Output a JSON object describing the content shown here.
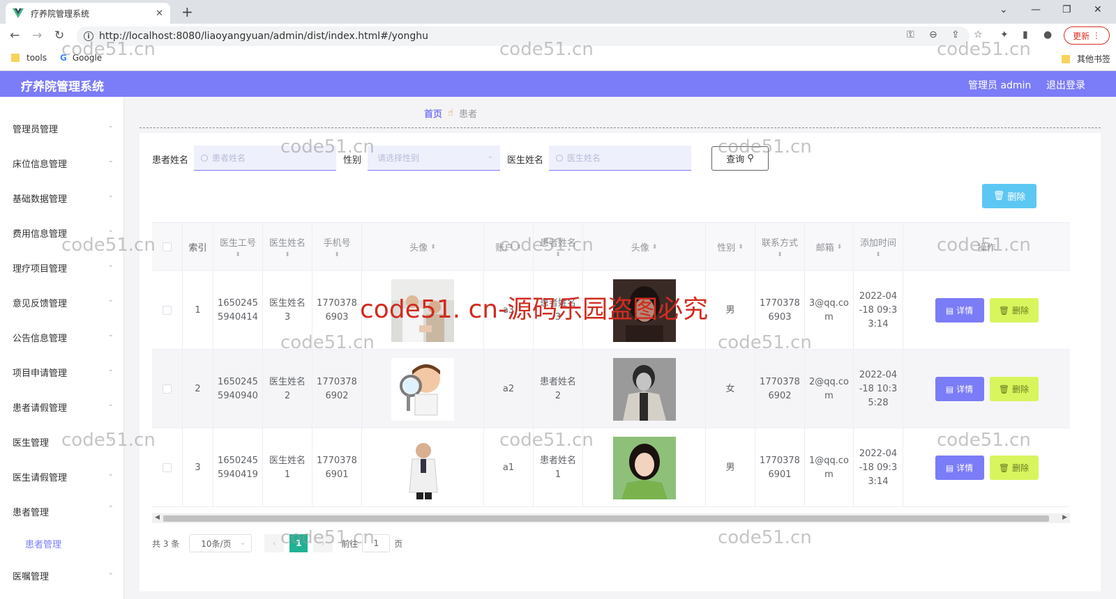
{
  "browser": {
    "tab_title": "疗养院管理系统",
    "url": "http://localhost:8080/liaoyangyuan/admin/dist/index.html#/yonghu",
    "update_label": "更新",
    "bookmarks": [
      "tools",
      "Google"
    ],
    "other_bookmarks": "其他书签"
  },
  "header": {
    "title": "疗养院管理系统",
    "admin": "管理员 admin",
    "logout": "退出登录"
  },
  "sidebar": {
    "items": [
      {
        "label": "管理员管理"
      },
      {
        "label": "床位信息管理"
      },
      {
        "label": "基础数据管理"
      },
      {
        "label": "费用信息管理"
      },
      {
        "label": "理疗项目管理"
      },
      {
        "label": "意见反馈管理"
      },
      {
        "label": "公告信息管理"
      },
      {
        "label": "项目申请管理"
      },
      {
        "label": "患者请假管理"
      },
      {
        "label": "医生管理"
      },
      {
        "label": "医生请假管理"
      },
      {
        "label": "患者管理"
      },
      {
        "label": "医嘱管理"
      }
    ],
    "sub_active": "患者管理"
  },
  "breadcrumb": {
    "home": "首页",
    "current": "患者"
  },
  "filters": {
    "patient_name_label": "患者姓名",
    "patient_name_placeholder": "患者姓名",
    "gender_label": "性别",
    "gender_placeholder": "请选择性别",
    "doctor_name_label": "医生姓名",
    "doctor_name_placeholder": "医生姓名",
    "query_label": "查询"
  },
  "actions": {
    "bulk_delete": "删除",
    "detail": "详情",
    "delete": "删除"
  },
  "table": {
    "columns": [
      "索引",
      "医生工号",
      "医生姓名",
      "手机号",
      "头像",
      "账户",
      "患者姓名",
      "头像",
      "性别",
      "联系方式",
      "邮箱",
      "添加时间",
      "操作"
    ],
    "rows": [
      {
        "index": "1",
        "doctor_no": "16502455940414",
        "doctor_name": "医生姓名3",
        "phone": "17703786903",
        "account": "a3",
        "patient_name": "患者姓名3",
        "gender": "男",
        "contact": "17703786903",
        "email": "3@qq.com",
        "added": "2022-04-18 09:33:14"
      },
      {
        "index": "2",
        "doctor_no": "16502455940940",
        "doctor_name": "医生姓名2",
        "phone": "17703786902",
        "account": "a2",
        "patient_name": "患者姓名2",
        "gender": "女",
        "contact": "17703786902",
        "email": "2@qq.com",
        "added": "2022-04-18 10:35:28"
      },
      {
        "index": "3",
        "doctor_no": "16502455940419",
        "doctor_name": "医生姓名1",
        "phone": "17703786901",
        "account": "a1",
        "patient_name": "患者姓名1",
        "gender": "男",
        "contact": "17703786901",
        "email": "1@qq.com",
        "added": "2022-04-18 09:33:14"
      }
    ]
  },
  "pagination": {
    "total": "共 3 条",
    "page_size": "10条/页",
    "current_page": "1",
    "goto_label": "前往",
    "goto_value": "1",
    "page_suffix": "页"
  },
  "watermark": {
    "text": "code51.cn",
    "red_text": "code51. cn-源码乐园盗图必究"
  },
  "colors": {
    "accent": "#7b7cf7",
    "delete_bulk": "#5cc7f3",
    "delete_row": "#d8f55d",
    "page_active": "#1fb394"
  }
}
